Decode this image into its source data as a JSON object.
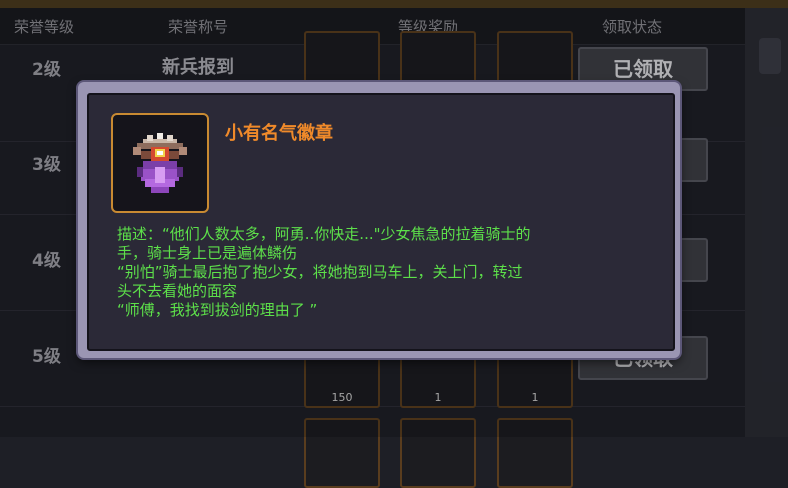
{
  "header": {
    "col_level": "荣誉等级",
    "col_title": "荣誉称号",
    "col_reward": "等级奖励",
    "col_status": "领取状态"
  },
  "rows": [
    {
      "level": "2级",
      "name": "新兵报到",
      "status": "已领取"
    },
    {
      "level": "3级",
      "name": "",
      "status": ""
    },
    {
      "level": "4级",
      "name": "",
      "status": ""
    },
    {
      "level": "5级",
      "name": "",
      "status": "已领取",
      "counts": [
        "150",
        "1",
        "1"
      ]
    }
  ],
  "modal": {
    "title": "小有名气徽章",
    "desc_lines": [
      "描述：“他们人数太多，阿勇..你快走...\"少女焦急的拉着骑士的",
      "手，骑士身上已是遍体鳞伤",
      "“别怕”骑士最后抱了抱少女，将她抱到马车上，关上门，转过",
      "头不去看她的面容",
      "“师傅，我找到拔剑的理由了 ”"
    ],
    "icon": "badge-icon"
  },
  "colors": {
    "title": "#f08a2a",
    "desc": "#5de04a",
    "frame": "#9a95b3",
    "panel": "#2b2937"
  }
}
